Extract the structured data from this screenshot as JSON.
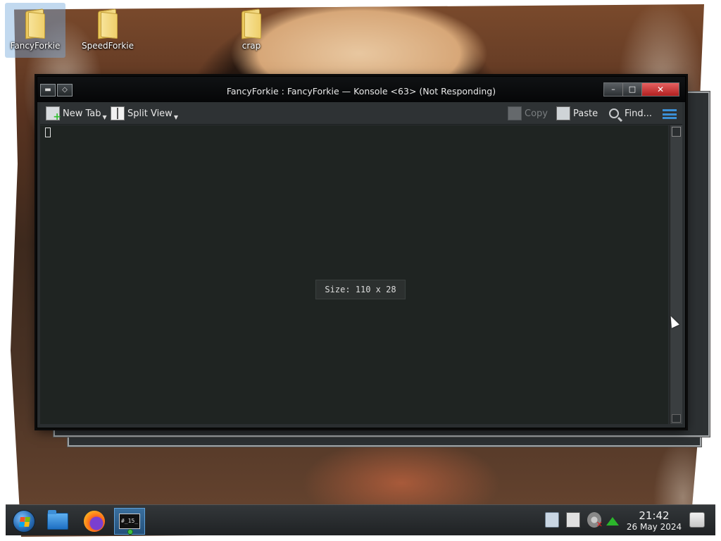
{
  "desktop": {
    "icons": [
      {
        "label": "FancyForkie",
        "selected": true,
        "icon": "folder-icon"
      },
      {
        "label": "SpeedForkie",
        "selected": false,
        "icon": "folder-icon"
      },
      {
        "label": "crap",
        "selected": false,
        "icon": "folder-icon"
      }
    ]
  },
  "window": {
    "title": "FancyForkie : FancyForkie — Konsole <63> (Not Responding)",
    "buttons": {
      "minimize": "–",
      "maximize": "□",
      "close": "✕"
    },
    "toolbar": {
      "new_tab": "New Tab",
      "split_view": "Split View",
      "copy": "Copy",
      "paste": "Paste",
      "find": "Find..."
    },
    "terminal": {
      "size_overlay": "Size: 110 x 28"
    }
  },
  "taskbar": {
    "items": [
      "start-menu",
      "file-manager",
      "firefox",
      "konsole"
    ],
    "konsole_icon_text": "#_15_",
    "clock": {
      "time": "21:42",
      "date": "26 May 2024"
    }
  },
  "colors": {
    "terminal_bg": "#1f2422",
    "titlebar": "#0a0c0d",
    "accent": "#3b8fd6",
    "close": "#d23a3a"
  }
}
